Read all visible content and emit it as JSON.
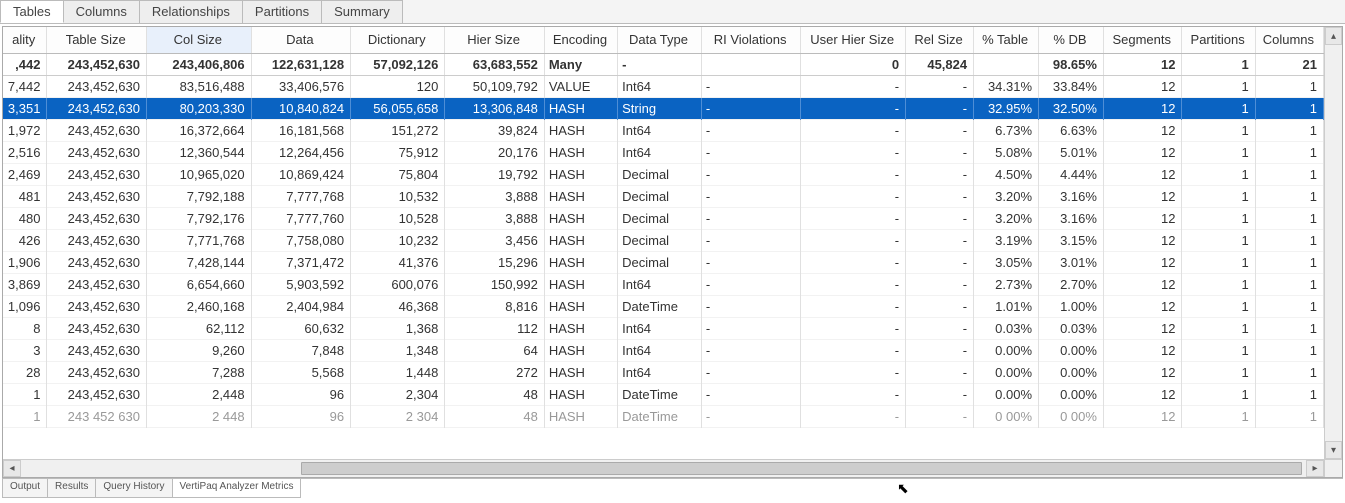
{
  "top_tabs": [
    "Tables",
    "Columns",
    "Relationships",
    "Partitions",
    "Summary"
  ],
  "top_tab_active": 0,
  "columns": [
    {
      "label": "ality",
      "align": "num"
    },
    {
      "label": "Table Size",
      "align": "num"
    },
    {
      "label": "Col Size",
      "align": "num",
      "active": true
    },
    {
      "label": "Data",
      "align": "num"
    },
    {
      "label": "Dictionary",
      "align": "num"
    },
    {
      "label": "Hier Size",
      "align": "num"
    },
    {
      "label": "Encoding",
      "align": "txt"
    },
    {
      "label": "Data Type",
      "align": "txt"
    },
    {
      "label": "RI Violations",
      "align": "txt"
    },
    {
      "label": "User Hier Size",
      "align": "num"
    },
    {
      "label": "Rel Size",
      "align": "num"
    },
    {
      "label": "% Table",
      "align": "num"
    },
    {
      "label": "% DB",
      "align": "num"
    },
    {
      "label": "Segments",
      "align": "num"
    },
    {
      "label": "Partitions",
      "align": "num"
    },
    {
      "label": "Columns",
      "align": "num"
    }
  ],
  "rows": [
    {
      "totals": true,
      "cells": [
        ",442",
        "243,452,630",
        "243,406,806",
        "122,631,128",
        "57,092,126",
        "63,683,552",
        "Many",
        "-",
        "",
        "",
        "0",
        "45,824",
        "",
        "98.65%",
        "12",
        "1",
        "21"
      ]
    },
    {
      "cells": [
        "7,442",
        "243,452,630",
        "83,516,488",
        "33,406,576",
        "120",
        "50,109,792",
        "VALUE",
        "Int64",
        "-",
        "",
        "-",
        "-",
        "34.31%",
        "33.84%",
        "12",
        "1",
        "1"
      ]
    },
    {
      "selected": true,
      "cells": [
        "3,351",
        "243,452,630",
        "80,203,330",
        "10,840,824",
        "56,055,658",
        "13,306,848",
        "HASH",
        "String",
        "-",
        "",
        "-",
        "-",
        "32.95%",
        "32.50%",
        "12",
        "1",
        "1"
      ]
    },
    {
      "cells": [
        "1,972",
        "243,452,630",
        "16,372,664",
        "16,181,568",
        "151,272",
        "39,824",
        "HASH",
        "Int64",
        "-",
        "",
        "-",
        "-",
        "6.73%",
        "6.63%",
        "12",
        "1",
        "1"
      ]
    },
    {
      "cells": [
        "2,516",
        "243,452,630",
        "12,360,544",
        "12,264,456",
        "75,912",
        "20,176",
        "HASH",
        "Int64",
        "-",
        "",
        "-",
        "-",
        "5.08%",
        "5.01%",
        "12",
        "1",
        "1"
      ]
    },
    {
      "cells": [
        "2,469",
        "243,452,630",
        "10,965,020",
        "10,869,424",
        "75,804",
        "19,792",
        "HASH",
        "Decimal",
        "-",
        "",
        "-",
        "-",
        "4.50%",
        "4.44%",
        "12",
        "1",
        "1"
      ]
    },
    {
      "cells": [
        "481",
        "243,452,630",
        "7,792,188",
        "7,777,768",
        "10,532",
        "3,888",
        "HASH",
        "Decimal",
        "-",
        "",
        "-",
        "-",
        "3.20%",
        "3.16%",
        "12",
        "1",
        "1"
      ]
    },
    {
      "cells": [
        "480",
        "243,452,630",
        "7,792,176",
        "7,777,760",
        "10,528",
        "3,888",
        "HASH",
        "Decimal",
        "-",
        "",
        "-",
        "-",
        "3.20%",
        "3.16%",
        "12",
        "1",
        "1"
      ]
    },
    {
      "cells": [
        "426",
        "243,452,630",
        "7,771,768",
        "7,758,080",
        "10,232",
        "3,456",
        "HASH",
        "Decimal",
        "-",
        "",
        "-",
        "-",
        "3.19%",
        "3.15%",
        "12",
        "1",
        "1"
      ]
    },
    {
      "cells": [
        "1,906",
        "243,452,630",
        "7,428,144",
        "7,371,472",
        "41,376",
        "15,296",
        "HASH",
        "Decimal",
        "-",
        "",
        "-",
        "-",
        "3.05%",
        "3.01%",
        "12",
        "1",
        "1"
      ]
    },
    {
      "cells": [
        "3,869",
        "243,452,630",
        "6,654,660",
        "5,903,592",
        "600,076",
        "150,992",
        "HASH",
        "Int64",
        "-",
        "",
        "-",
        "-",
        "2.73%",
        "2.70%",
        "12",
        "1",
        "1"
      ]
    },
    {
      "cells": [
        "1,096",
        "243,452,630",
        "2,460,168",
        "2,404,984",
        "46,368",
        "8,816",
        "HASH",
        "DateTime",
        "-",
        "",
        "-",
        "-",
        "1.01%",
        "1.00%",
        "12",
        "1",
        "1"
      ]
    },
    {
      "cells": [
        "8",
        "243,452,630",
        "62,112",
        "60,632",
        "1,368",
        "112",
        "HASH",
        "Int64",
        "-",
        "",
        "-",
        "-",
        "0.03%",
        "0.03%",
        "12",
        "1",
        "1"
      ]
    },
    {
      "cells": [
        "3",
        "243,452,630",
        "9,260",
        "7,848",
        "1,348",
        "64",
        "HASH",
        "Int64",
        "-",
        "",
        "-",
        "-",
        "0.00%",
        "0.00%",
        "12",
        "1",
        "1"
      ]
    },
    {
      "cells": [
        "28",
        "243,452,630",
        "7,288",
        "5,568",
        "1,448",
        "272",
        "HASH",
        "Int64",
        "-",
        "",
        "-",
        "-",
        "0.00%",
        "0.00%",
        "12",
        "1",
        "1"
      ]
    },
    {
      "cells": [
        "1",
        "243,452,630",
        "2,448",
        "96",
        "2,304",
        "48",
        "HASH",
        "DateTime",
        "-",
        "",
        "-",
        "-",
        "0.00%",
        "0.00%",
        "12",
        "1",
        "1"
      ]
    },
    {
      "faded": true,
      "cells": [
        "1",
        "243 452 630",
        "2 448",
        "96",
        "2 304",
        "48",
        "HASH",
        "DateTime",
        "-",
        "",
        "-",
        "-",
        "0 00%",
        "0 00%",
        "12",
        "1",
        "1"
      ]
    }
  ],
  "bottom_tabs": [
    "Output",
    "Results",
    "Query History",
    "VertiPaq Analyzer Metrics"
  ],
  "bottom_tab_active": 3
}
